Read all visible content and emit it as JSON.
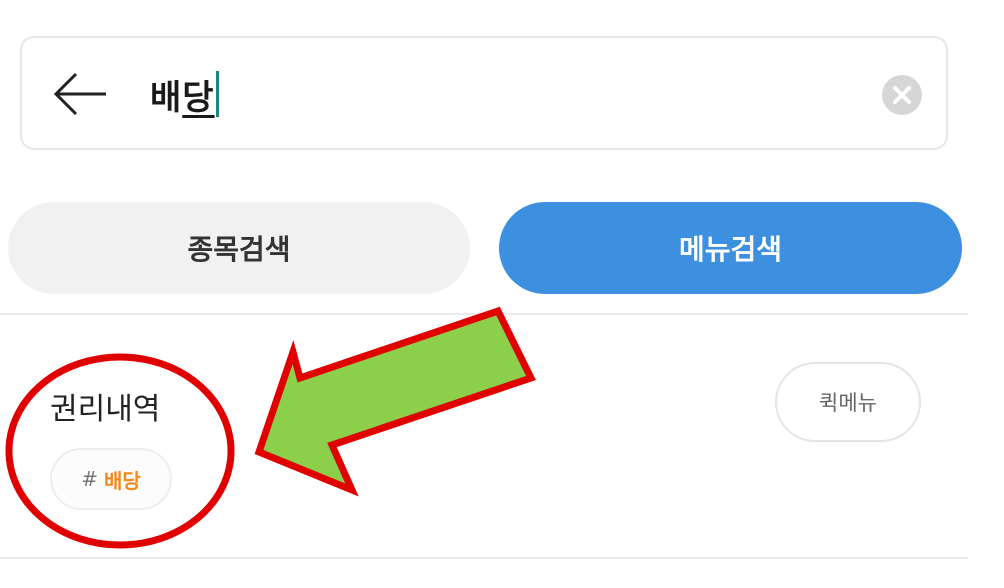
{
  "search": {
    "query_prefix": "배",
    "query_underlined": "당"
  },
  "tabs": [
    {
      "label": "종목검색",
      "active": false
    },
    {
      "label": "메뉴검색",
      "active": true
    }
  ],
  "results": [
    {
      "title": "권리내역",
      "tag_hash": "#",
      "tag_word": "배당",
      "quick_menu_label": "퀵메뉴"
    }
  ],
  "colors": {
    "active_tab": "#3d8fe0",
    "tag_highlight": "#f08a1c",
    "annotation_circle": "#e00000",
    "annotation_arrow_fill": "#8ccf4a",
    "caret": "#1a8a7a"
  },
  "annotations": {
    "circle": "red-ellipse-around-result",
    "arrow": "green-arrow-pointing-to-result"
  }
}
